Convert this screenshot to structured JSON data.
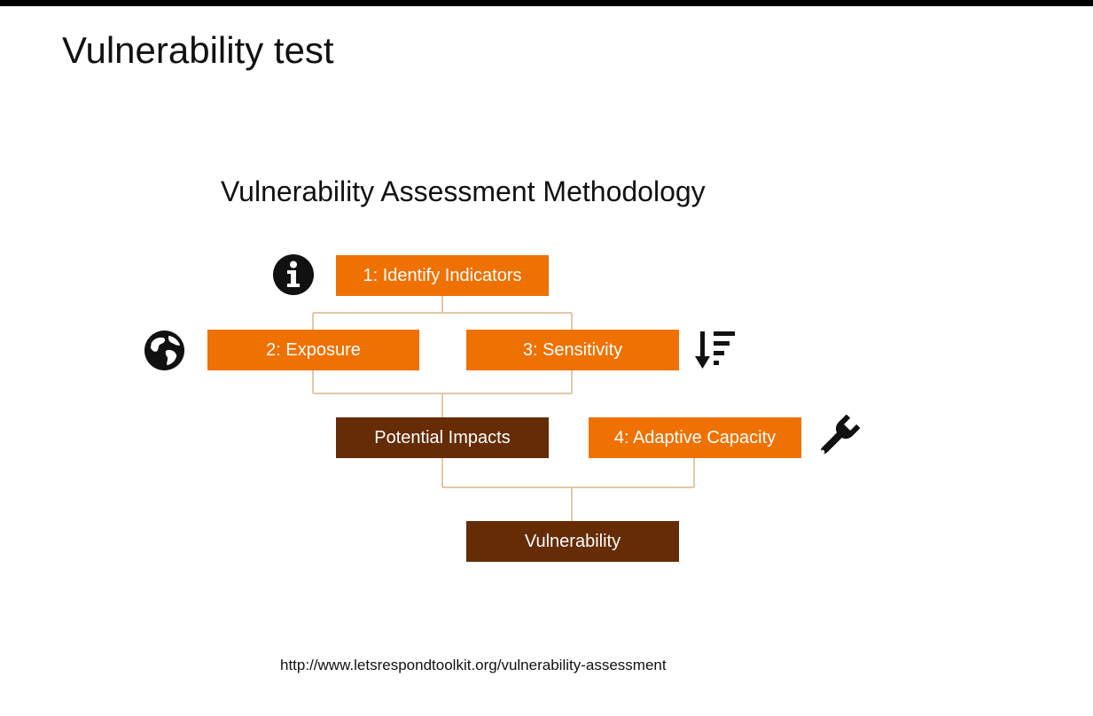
{
  "slide": {
    "title": "Vulnerability test"
  },
  "diagram": {
    "title": "Vulnerability Assessment Methodology",
    "steps": {
      "identify": "1: Identify Indicators",
      "exposure": "2: Exposure",
      "sensitivity": "3: Sensitivity",
      "potential_impacts": "Potential Impacts",
      "adaptive_capacity": "4: Adaptive Capacity",
      "vulnerability": "Vulnerability"
    },
    "icons": {
      "identify": "info-icon",
      "exposure": "globe-icon",
      "sensitivity": "sort-descending-icon",
      "adaptive_capacity": "wrench-icon"
    },
    "colors": {
      "step_box": "#ee7102",
      "result_box": "#652c06",
      "connector": "#e0c8a8"
    }
  },
  "footer": {
    "source_url": "http://www.letsrespondtoolkit.org/vulnerability-assessment"
  }
}
